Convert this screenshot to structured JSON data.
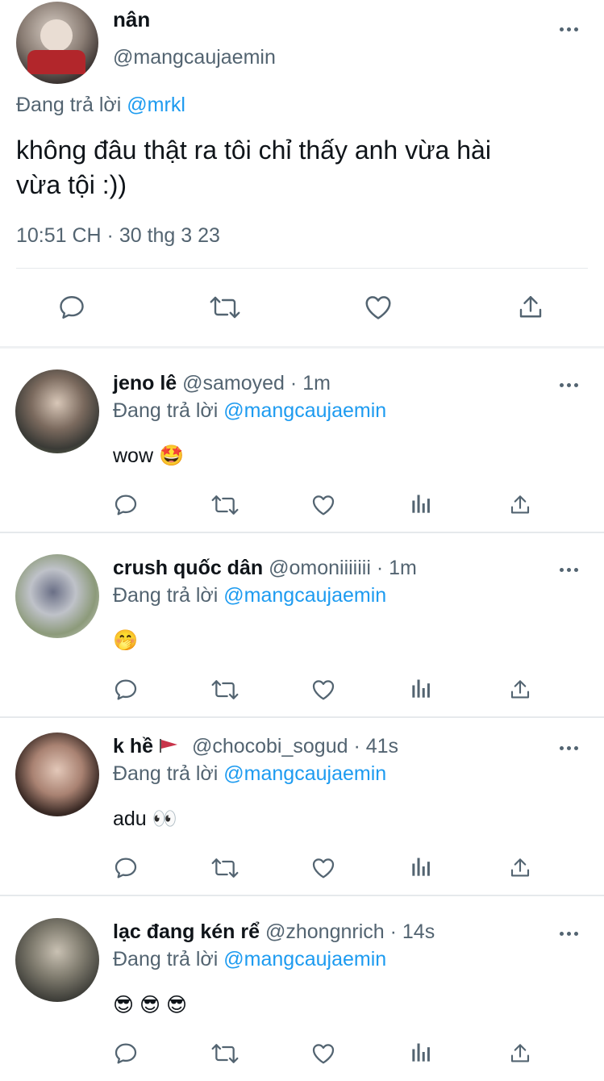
{
  "main_tweet": {
    "name": "nân",
    "handle": "@mangcaujaemin",
    "reply_prefix": "Đang trả lời",
    "reply_to": "@mrkl",
    "text_line1": "không đâu thật ra tôi chỉ thấy anh vừa hài",
    "text_line2": "vừa tội :))",
    "timestamp": "10:51 CH · 30 thg 3 23"
  },
  "icons": {
    "reply": "reply-icon",
    "retweet": "retweet-icon",
    "like": "heart-icon",
    "share": "share-icon",
    "analytics": "analytics-icon",
    "more": "more-icon"
  },
  "replies": [
    {
      "name": "jeno lê",
      "handle": "@samoyed",
      "time": "· 1m",
      "reply_prefix": "Đang trả lời",
      "reply_to": "@mangcaujaemin",
      "text": "wow 🤩"
    },
    {
      "name": "crush quốc dân",
      "handle": "@omoniiiiiii",
      "time": "· 1m",
      "reply_prefix": "Đang trả lời",
      "reply_to": "@mangcaujaemin",
      "text": "🤭"
    },
    {
      "name": "k hề",
      "handle": "@chocobi_sogud",
      "time": "· 41s",
      "reply_prefix": "Đang trả lời",
      "reply_to": "@mangcaujaemin",
      "text": "adu 👀"
    },
    {
      "name": "lạc đang kén rể",
      "handle": "@zhongnrich",
      "time": "· 14s",
      "reply_prefix": "Đang trả lời",
      "reply_to": "@mangcaujaemin",
      "text": "😎 😎 😎"
    }
  ]
}
